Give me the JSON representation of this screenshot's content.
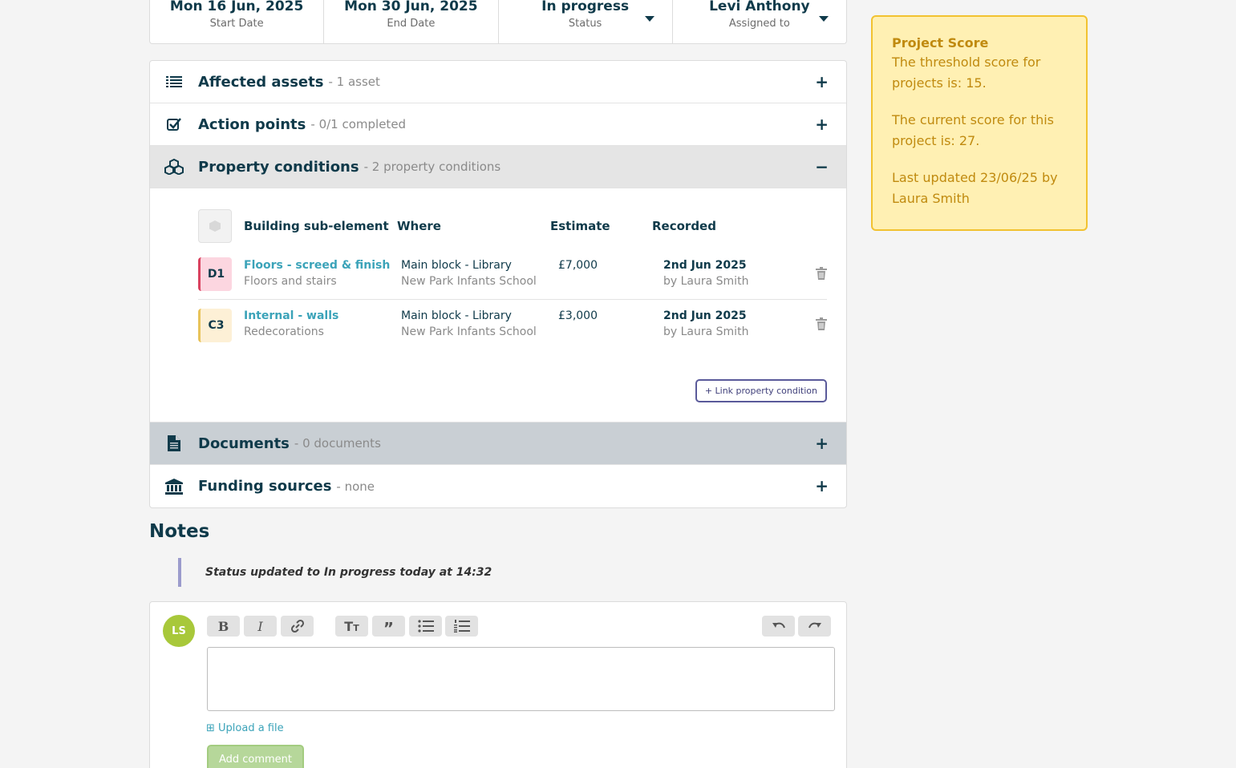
{
  "summary": {
    "start_date": "Mon 16 Jun, 2025",
    "start_label": "Start Date",
    "end_date": "Mon 30 Jun, 2025",
    "end_label": "End Date",
    "status_value": "In progress",
    "status_label": "Status",
    "assignee_value": "Levi Anthony",
    "assignee_label": "Assigned to"
  },
  "accordion": {
    "affected_assets": {
      "title": "Affected assets",
      "sub": "- 1 asset",
      "toggle": "+"
    },
    "action_points": {
      "title": "Action points",
      "sub": "- 0/1 completed",
      "toggle": "+"
    },
    "property_conditions": {
      "title": "Property conditions",
      "sub": "- 2 property conditions",
      "toggle": "−"
    },
    "documents": {
      "title": "Documents",
      "sub": "- 0 documents",
      "toggle": "+"
    },
    "funding_sources": {
      "title": "Funding sources",
      "sub": "- none",
      "toggle": "+"
    }
  },
  "property_conditions": {
    "headers": {
      "element": "Building sub-element",
      "where": "Where",
      "estimate": "Estimate",
      "recorded": "Recorded"
    },
    "rows": [
      {
        "grade": "D1",
        "name": "Floors - screed & finish",
        "category": "Floors and stairs",
        "where1": "Main block - Library",
        "where2": "New Park Infants School",
        "estimate": "£7,000",
        "date": "2nd Jun 2025",
        "by": "by Laura Smith"
      },
      {
        "grade": "C3",
        "name": "Internal - walls",
        "category": "Redecorations",
        "where1": "Main block - Library",
        "where2": "New Park Infants School",
        "estimate": "£3,000",
        "date": "2nd Jun 2025",
        "by": "by Laura Smith"
      }
    ],
    "link_button": "+ Link property condition"
  },
  "score": {
    "title": "Project Score",
    "threshold": "The threshold score for projects is: 15.",
    "current": "The current score for this project is: 27.",
    "updated": "Last updated 23/06/25 by Laura Smith",
    "colors": {
      "bg": "#fff0b3",
      "border": "#f2c230",
      "text": "#c08a0f"
    }
  },
  "notes": {
    "title": "Notes",
    "status_note": "Status updated to In progress today at 14:32",
    "avatar_initials": "LS",
    "upload_label": "⊞ Upload a file",
    "add_comment": "Add comment"
  }
}
